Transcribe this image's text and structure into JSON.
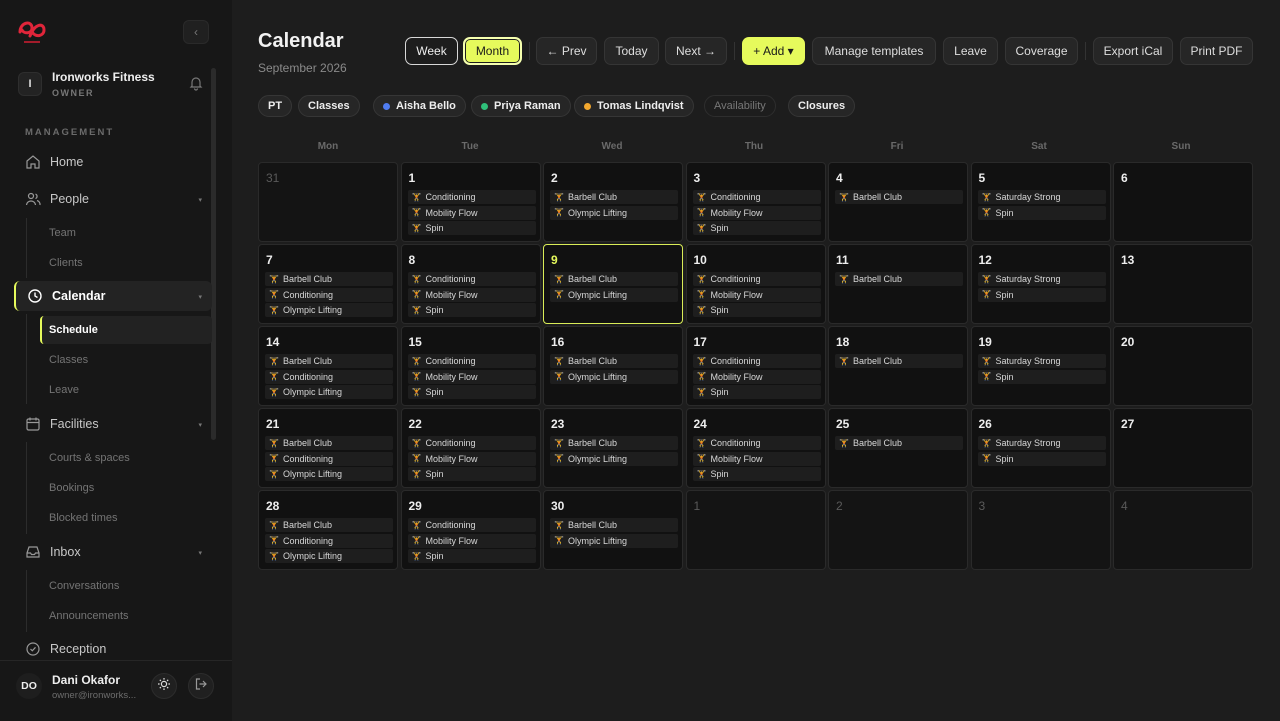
{
  "org": {
    "initial": "I",
    "name": "Ironworks Fitness",
    "role": "OWNER"
  },
  "sidebar": {
    "section": "MANAGEMENT",
    "home": "Home",
    "people": "People",
    "people_sub": [
      "Team",
      "Clients"
    ],
    "calendar": "Calendar",
    "calendar_sub": [
      "Schedule",
      "Classes",
      "Leave"
    ],
    "facilities": "Facilities",
    "facilities_sub": [
      "Courts & spaces",
      "Bookings",
      "Blocked times"
    ],
    "inbox": "Inbox",
    "inbox_sub": [
      "Conversations",
      "Announcements"
    ],
    "reception": "Reception"
  },
  "user": {
    "initials": "DO",
    "name": "Dani Okafor",
    "email": "owner@ironworks..."
  },
  "header": {
    "title": "Calendar",
    "subtitle": "September 2026"
  },
  "toolbar": {
    "week": "Week",
    "month": "Month",
    "prev": "← Prev",
    "today": "Today",
    "next": "Next →",
    "add": "+ Add ▾",
    "templates": "Manage templates",
    "leave": "Leave",
    "coverage": "Coverage",
    "export": "Export iCal",
    "print": "Print PDF"
  },
  "filters": {
    "pt": "PT",
    "classes": "Classes",
    "aisha": "Aisha Bello",
    "priya": "Priya Raman",
    "tomas": "Tomas Lindqvist",
    "availability": "Availability",
    "closures": "Closures"
  },
  "colors": {
    "accent": "#e6fa5c",
    "aisha": "#4f7cf0",
    "priya": "#2fc07a",
    "tomas": "#f2a72e"
  },
  "weekdays": [
    "Mon",
    "Tue",
    "Wed",
    "Thu",
    "Fri",
    "Sat",
    "Sun"
  ],
  "calendar": {
    "days": [
      {
        "n": "31",
        "out": true,
        "ev": []
      },
      {
        "n": "1",
        "ev": [
          "Conditioning",
          "Mobility Flow",
          "Spin"
        ]
      },
      {
        "n": "2",
        "ev": [
          "Barbell Club",
          "Olympic Lifting"
        ]
      },
      {
        "n": "3",
        "ev": [
          "Conditioning",
          "Mobility Flow",
          "Spin"
        ]
      },
      {
        "n": "4",
        "ev": [
          "Barbell Club"
        ]
      },
      {
        "n": "5",
        "ev": [
          "Saturday Strong",
          "Spin"
        ]
      },
      {
        "n": "6",
        "ev": []
      },
      {
        "n": "7",
        "ev": [
          "Barbell Club",
          "Conditioning",
          "Olympic Lifting"
        ]
      },
      {
        "n": "8",
        "ev": [
          "Conditioning",
          "Mobility Flow",
          "Spin"
        ]
      },
      {
        "n": "9",
        "today": true,
        "ev": [
          "Barbell Club",
          "Olympic Lifting"
        ]
      },
      {
        "n": "10",
        "ev": [
          "Conditioning",
          "Mobility Flow",
          "Spin"
        ]
      },
      {
        "n": "11",
        "ev": [
          "Barbell Club"
        ]
      },
      {
        "n": "12",
        "ev": [
          "Saturday Strong",
          "Spin"
        ]
      },
      {
        "n": "13",
        "ev": []
      },
      {
        "n": "14",
        "ev": [
          "Barbell Club",
          "Conditioning",
          "Olympic Lifting"
        ]
      },
      {
        "n": "15",
        "ev": [
          "Conditioning",
          "Mobility Flow",
          "Spin"
        ]
      },
      {
        "n": "16",
        "ev": [
          "Barbell Club",
          "Olympic Lifting"
        ]
      },
      {
        "n": "17",
        "ev": [
          "Conditioning",
          "Mobility Flow",
          "Spin"
        ]
      },
      {
        "n": "18",
        "ev": [
          "Barbell Club"
        ]
      },
      {
        "n": "19",
        "ev": [
          "Saturday Strong",
          "Spin"
        ]
      },
      {
        "n": "20",
        "ev": []
      },
      {
        "n": "21",
        "ev": [
          "Barbell Club",
          "Conditioning",
          "Olympic Lifting"
        ]
      },
      {
        "n": "22",
        "ev": [
          "Conditioning",
          "Mobility Flow",
          "Spin"
        ]
      },
      {
        "n": "23",
        "ev": [
          "Barbell Club",
          "Olympic Lifting"
        ]
      },
      {
        "n": "24",
        "ev": [
          "Conditioning",
          "Mobility Flow",
          "Spin"
        ]
      },
      {
        "n": "25",
        "ev": [
          "Barbell Club"
        ]
      },
      {
        "n": "26",
        "ev": [
          "Saturday Strong",
          "Spin"
        ]
      },
      {
        "n": "27",
        "ev": []
      },
      {
        "n": "28",
        "ev": [
          "Barbell Club",
          "Conditioning",
          "Olympic Lifting"
        ]
      },
      {
        "n": "29",
        "ev": [
          "Conditioning",
          "Mobility Flow",
          "Spin"
        ]
      },
      {
        "n": "30",
        "ev": [
          "Barbell Club",
          "Olympic Lifting"
        ]
      },
      {
        "n": "1",
        "out": true,
        "ev": []
      },
      {
        "n": "2",
        "out": true,
        "ev": []
      },
      {
        "n": "3",
        "out": true,
        "ev": []
      },
      {
        "n": "4",
        "out": true,
        "ev": []
      }
    ]
  }
}
